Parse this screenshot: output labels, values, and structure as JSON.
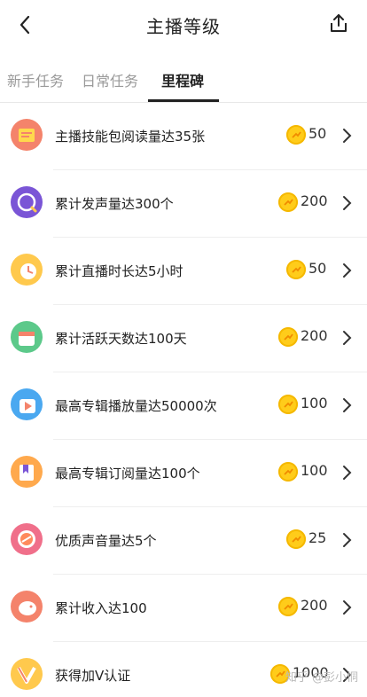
{
  "header": {
    "title": "主播等级"
  },
  "tabs": [
    {
      "label": "新手任务",
      "active": false
    },
    {
      "label": "日常任务",
      "active": false
    },
    {
      "label": "里程碑",
      "active": true
    }
  ],
  "items": [
    {
      "label": "主播技能包阅读量达35张",
      "reward": "50",
      "icon": "book-icon"
    },
    {
      "label": "累计发声量达300个",
      "reward": "200",
      "icon": "microphone-icon"
    },
    {
      "label": "累计直播时长达5小时",
      "reward": "50",
      "icon": "clock-icon"
    },
    {
      "label": "累计活跃天数达100天",
      "reward": "200",
      "icon": "calendar-icon"
    },
    {
      "label": "最高专辑播放量达50000次",
      "reward": "100",
      "icon": "play-icon"
    },
    {
      "label": "最高专辑订阅量达100个",
      "reward": "100",
      "icon": "bookmark-icon"
    },
    {
      "label": "优质声音量达5个",
      "reward": "25",
      "icon": "sound-icon"
    },
    {
      "label": "累计收入达100",
      "reward": "200",
      "icon": "piggy-bank-icon"
    },
    {
      "label": "获得加V认证",
      "reward": "1000",
      "icon": "v-badge-icon"
    }
  ],
  "watermark": "知乎 @彭小恫",
  "colors": {
    "coin": "#ffcc1a",
    "active_tab": "#222222",
    "inactive_tab": "#9a9a9a"
  }
}
